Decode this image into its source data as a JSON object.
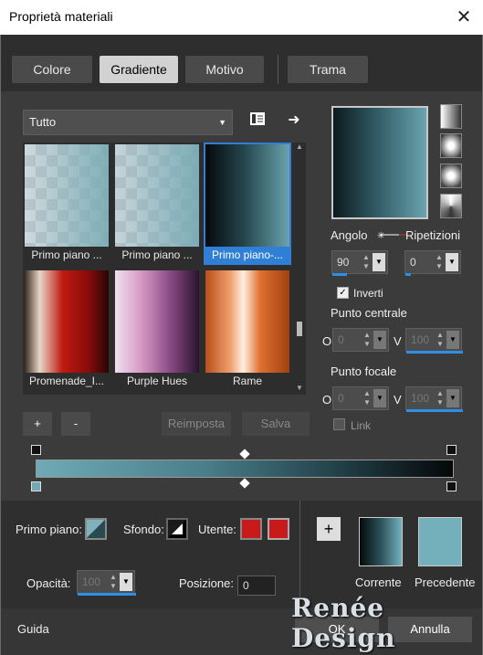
{
  "window": {
    "title": "Proprietà materiali",
    "close_glyph": "✕"
  },
  "tabs": [
    {
      "label": "Colore",
      "active": false
    },
    {
      "label": "Gradiente",
      "active": true
    },
    {
      "label": "Motivo",
      "active": false
    },
    {
      "label": "Trama",
      "active": false
    }
  ],
  "filter": {
    "selected": "Tutto"
  },
  "gallery": {
    "items": [
      {
        "label": "Primo piano ...",
        "selected": false
      },
      {
        "label": "Primo piano ...",
        "selected": false
      },
      {
        "label": "Primo piano-...",
        "selected": true
      },
      {
        "label": "Promenade_I...",
        "selected": false
      },
      {
        "label": "Purple Hues",
        "selected": false
      },
      {
        "label": "Rame",
        "selected": false
      }
    ]
  },
  "buttons": {
    "add": "+",
    "remove": "-",
    "reset": "Reimposta",
    "save": "Salva"
  },
  "settings": {
    "angle_label": "Angolo",
    "angle_value": "90",
    "repeat_label": "Ripetizioni",
    "repeat_value": "0",
    "invert_label": "Inverti",
    "invert_checked": true,
    "center_label": "Punto centrale",
    "center_o_label": "O",
    "center_o_value": "0",
    "center_v_label": "V",
    "center_v_value": "100",
    "focal_label": "Punto focale",
    "focal_o_label": "O",
    "focal_o_value": "0",
    "focal_v_label": "V",
    "focal_v_value": "100",
    "link_label": "Link",
    "link_checked": false
  },
  "lower": {
    "foreground_label": "Primo piano:",
    "background_label": "Sfondo:",
    "user_label": "Utente:",
    "opacity_label": "Opacità:",
    "opacity_value": "100",
    "position_label": "Posizione:",
    "position_value": "0",
    "user_color": "#c81a1a",
    "current_label": "Corrente",
    "previous_label": "Precedente",
    "previous_color": "#74b0bc"
  },
  "footer": {
    "help": "Guida",
    "ok": "OK",
    "cancel": "Annulla",
    "watermark": "Renée Design"
  },
  "colors": {
    "accent": "#2f7fd6",
    "gradient_start": "#6faab5",
    "gradient_end": "#050808"
  },
  "icons": [
    "close-icon",
    "library-icon",
    "arrow-right-icon",
    "chevron-down-icon",
    "linear-style-icon",
    "rectangular-style-icon",
    "radial-style-icon",
    "sunburst-style-icon",
    "plus-icon",
    "check-icon"
  ]
}
